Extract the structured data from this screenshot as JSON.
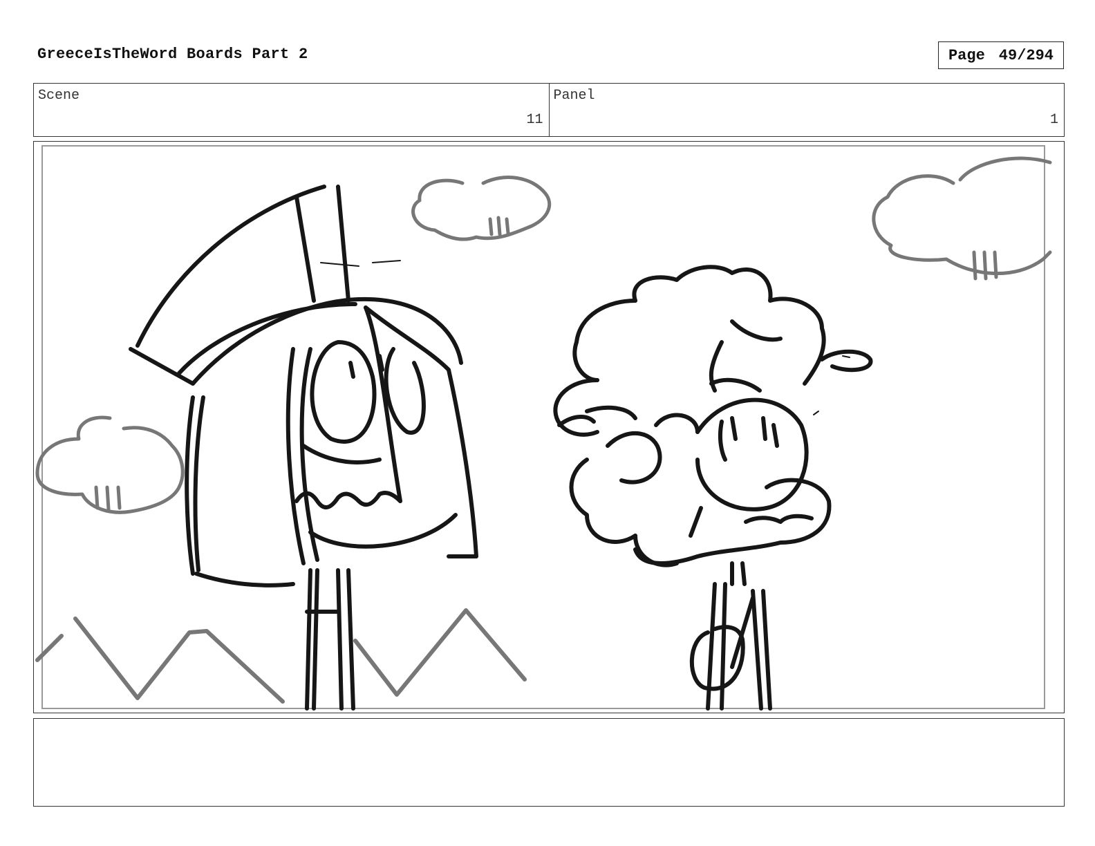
{
  "header": {
    "title": "GreeceIsTheWord Boards Part 2",
    "page_label": "Page",
    "page_number": "49/294"
  },
  "info": {
    "scene_label": "Scene",
    "scene_value": "11",
    "panel_label": "Panel",
    "panel_value": "1"
  },
  "notes": {
    "text": ""
  }
}
